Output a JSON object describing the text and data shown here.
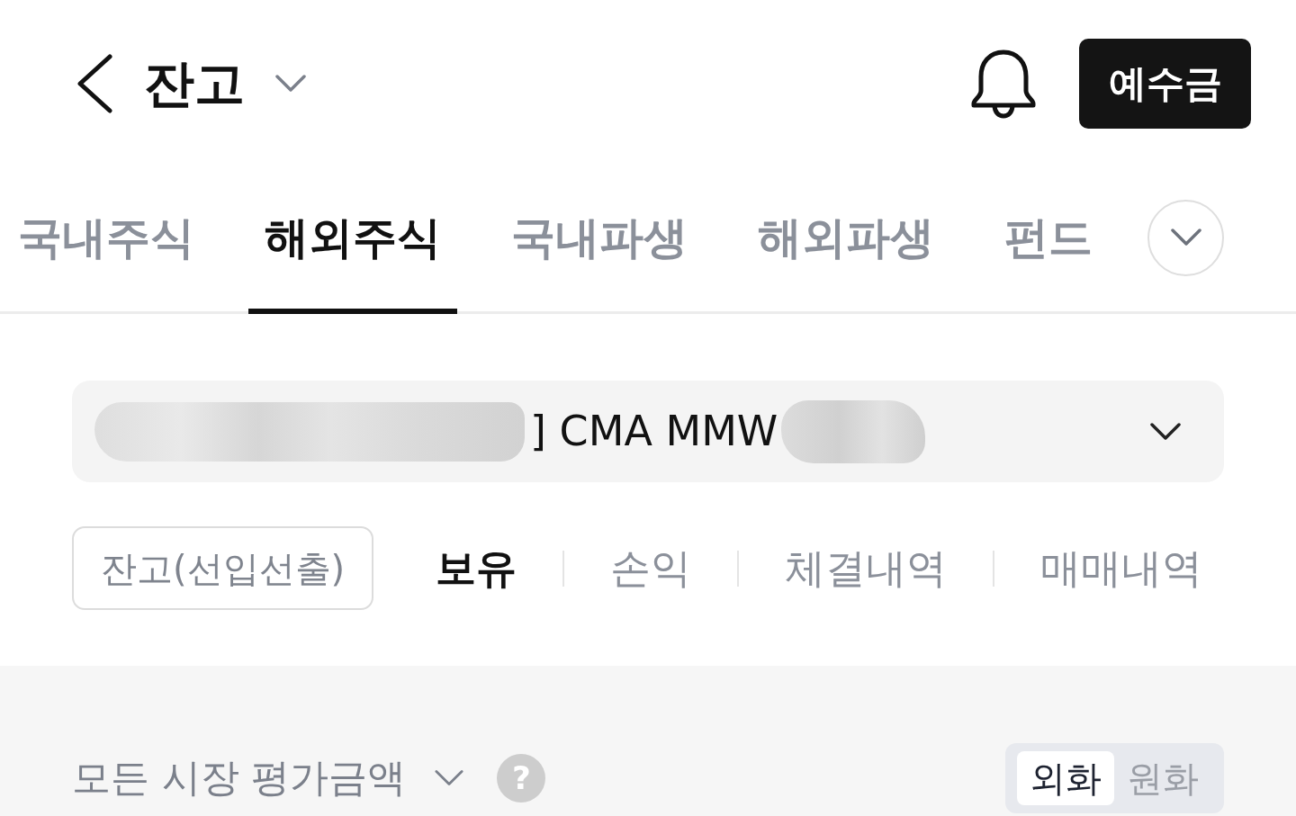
{
  "header": {
    "title": "잔고",
    "deposit_button": "예수금"
  },
  "tabs": [
    {
      "label": "국내주식",
      "selected": false
    },
    {
      "label": "해외주식",
      "selected": true
    },
    {
      "label": "국내파생",
      "selected": false
    },
    {
      "label": "해외파생",
      "selected": false
    },
    {
      "label": "펀드",
      "selected": false
    }
  ],
  "account_selector": {
    "value": "] CMA MMW",
    "masked": true
  },
  "filters": [
    {
      "label": "잔고(선입선출)",
      "kind": "outlined",
      "selected": false
    },
    {
      "label": "보유",
      "kind": "plain",
      "selected": true
    },
    {
      "label": "손익",
      "kind": "plain",
      "selected": false
    },
    {
      "label": "체결내역",
      "kind": "plain",
      "selected": false
    },
    {
      "label": "매매내역",
      "kind": "plain",
      "selected": false
    }
  ],
  "valuation": {
    "label": "모든 시장 평가금액",
    "help": "?",
    "currencies": [
      {
        "label": "외화",
        "selected": true
      },
      {
        "label": "원화",
        "selected": false
      }
    ]
  }
}
